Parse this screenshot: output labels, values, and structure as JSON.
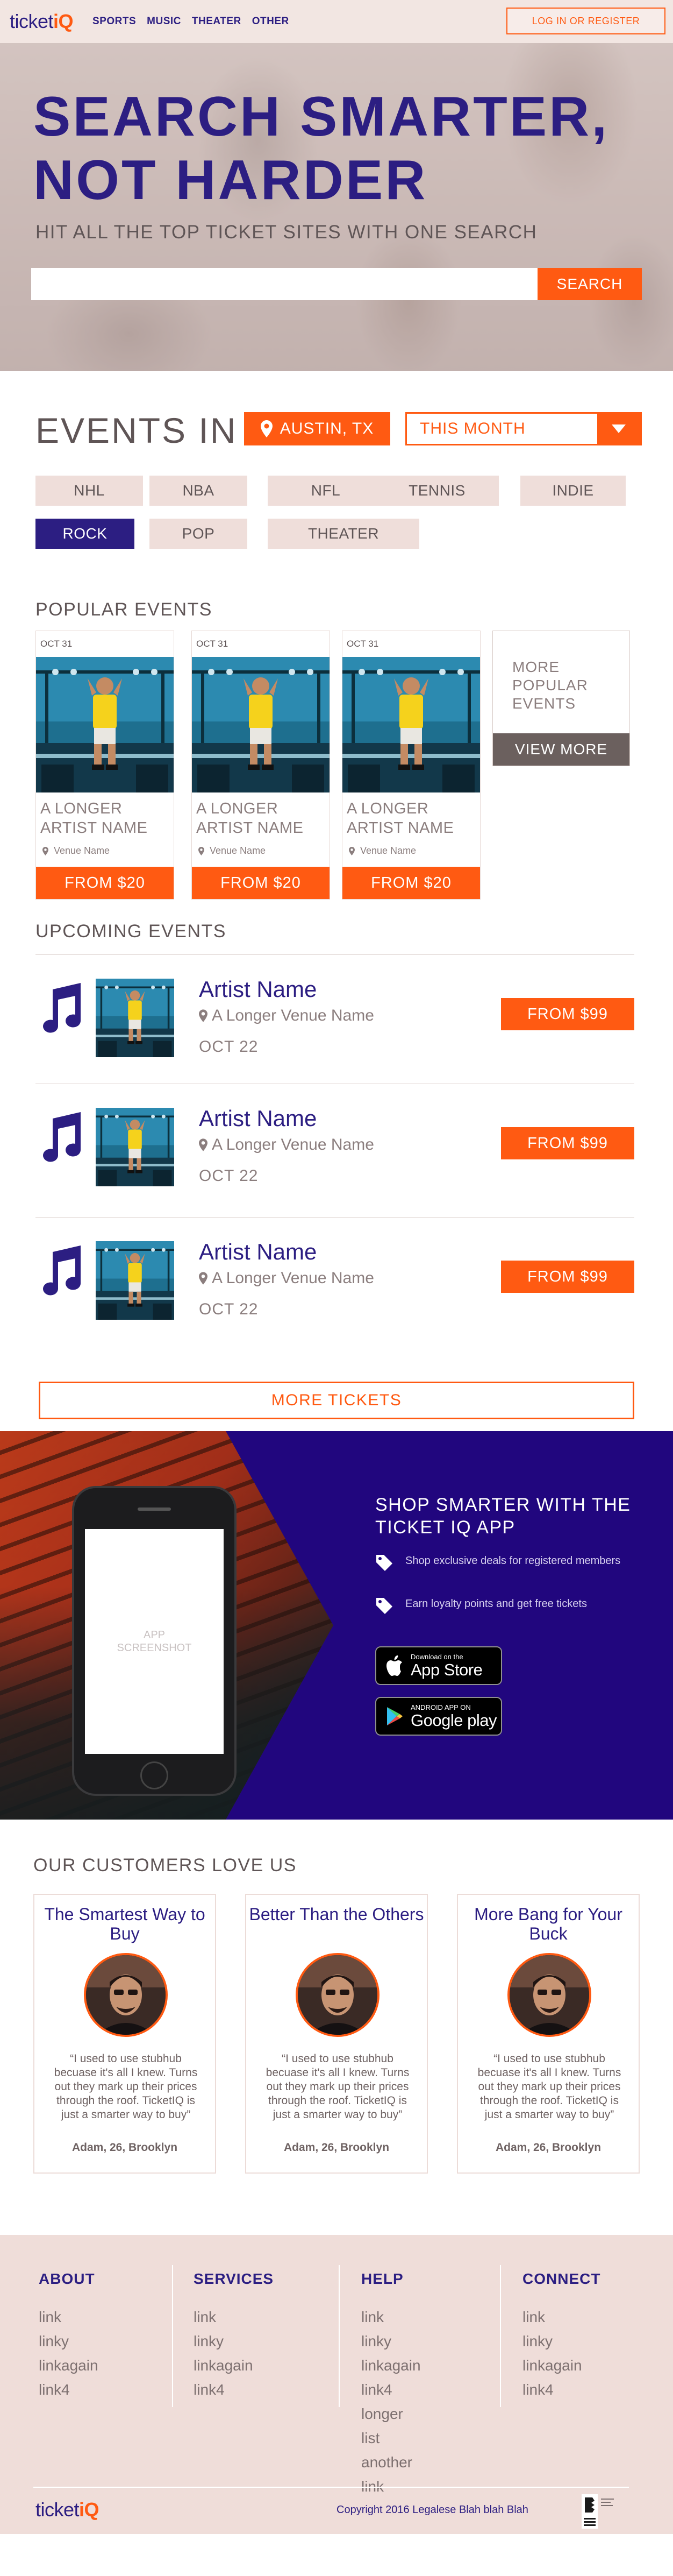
{
  "brand": {
    "name_part1": "ticket",
    "name_part2": "iQ"
  },
  "nav": {
    "links": [
      "SPORTS",
      "MUSIC",
      "THEATER",
      "OTHER"
    ],
    "login_label": "LOG IN OR REGISTER"
  },
  "hero": {
    "title_line1": "SEARCH SMARTER,",
    "title_line2": "NOT HARDER",
    "subtitle": "HIT ALL THE TOP TICKET SITES WITH ONE SEARCH",
    "search_value": "",
    "search_button": "SEARCH"
  },
  "events_in": {
    "title": "EVENTS IN",
    "location": "AUSTIN, TX",
    "period": "THIS MONTH",
    "categories": [
      "NHL",
      "NBA",
      "NFL",
      "TENNIS",
      "INDIE",
      "ROCK",
      "POP",
      "THEATER"
    ],
    "selected_category": "ROCK"
  },
  "popular": {
    "title": "POPULAR EVENTS",
    "cards": [
      {
        "date": "OCT 31",
        "artist": "A LONGER ARTIST NAME",
        "venue": "Venue Name",
        "price": "FROM $20"
      },
      {
        "date": "OCT 31",
        "artist": "A LONGER ARTIST NAME",
        "venue": "Venue Name",
        "price": "FROM $20"
      },
      {
        "date": "OCT 31",
        "artist": "A LONGER ARTIST NAME",
        "venue": "Venue Name",
        "price": "FROM $20"
      }
    ],
    "more_text": "MORE POPULAR EVENTS",
    "more_button": "VIEW MORE"
  },
  "upcoming": {
    "title": "UPCOMING EVENTS",
    "rows": [
      {
        "artist": "Artist Name",
        "venue": "A Longer Venue Name",
        "date": "OCT 22",
        "price": "FROM $99"
      },
      {
        "artist": "Artist Name",
        "venue": "A Longer Venue Name",
        "date": "OCT 22",
        "price": "FROM $99"
      },
      {
        "artist": "Artist Name",
        "venue": "A Longer Venue Name",
        "date": "OCT 22",
        "price": "FROM $99"
      }
    ],
    "more_button": "MORE TICKETS"
  },
  "app_promo": {
    "title": "SHOP SMARTER WITH THE TICKET IQ APP",
    "perks": [
      "Shop exclusive deals for registered members",
      "Earn loyalty points and get free tickets"
    ],
    "screen_placeholder": "APP SCREENSHOT",
    "app_store_small": "Download on the",
    "app_store_big": "App Store",
    "google_small": "ANDROID APP ON",
    "google_big": "Google play"
  },
  "testimonials": {
    "title": "OUR CUSTOMERS LOVE US",
    "cards": [
      {
        "title": "The Smartest Way to Buy",
        "quote": "“I used to use stubhub becuase it's all I knew. Turns out they mark up their prices through the roof. TicketIQ is just a smarter way to buy”",
        "author": "Adam, 26, Brooklyn"
      },
      {
        "title": "Better Than the Others",
        "quote": "“I used to use stubhub becuase it's all I knew. Turns out they mark up their prices through the roof. TicketIQ is just a smarter way to buy”",
        "author": "Adam, 26, Brooklyn"
      },
      {
        "title": "More Bang for Your Buck",
        "quote": "“I used to use stubhub becuase it's all I knew. Turns out they mark up their prices through the roof. TicketIQ is just a smarter way to buy”",
        "author": "Adam, 26, Brooklyn"
      }
    ]
  },
  "footer": {
    "columns": [
      {
        "heading": "ABOUT",
        "links": [
          "link",
          "linky",
          "linkagain",
          "link4"
        ]
      },
      {
        "heading": "SERVICES",
        "links": [
          "link",
          "linky",
          "linkagain",
          "link4"
        ]
      },
      {
        "heading": "HELP",
        "links": [
          "link",
          "linky",
          "linkagain",
          "link4",
          "longer list",
          "another link"
        ]
      },
      {
        "heading": "CONNECT",
        "links": [
          "link",
          "linky",
          "linkagain",
          "link4"
        ]
      }
    ],
    "copyright": "Copyright 2016 Legalese Blah blah Blah"
  },
  "colors": {
    "primary": "#2c1e82",
    "accent": "#ff5a12",
    "muted": "#5f5556",
    "blush": "#efddd9"
  },
  "icons": {
    "location": "map-pin-icon",
    "dropdown": "caret-down-icon",
    "music": "music-note-icon",
    "tag": "tag-icon",
    "apple": "apple-icon",
    "google_play": "google-play-icon"
  }
}
